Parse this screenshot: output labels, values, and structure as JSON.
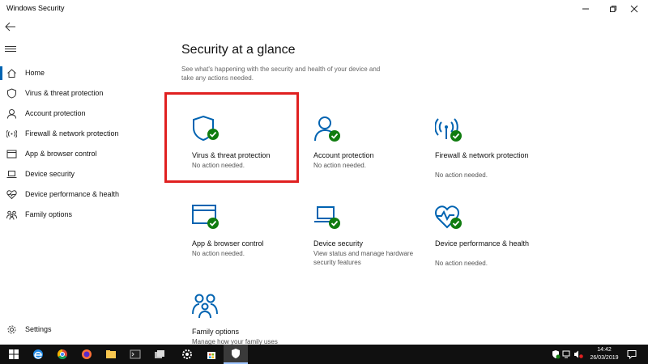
{
  "window": {
    "title": "Windows Security"
  },
  "sidebar": {
    "items": [
      {
        "label": "Home"
      },
      {
        "label": "Virus & threat protection"
      },
      {
        "label": "Account protection"
      },
      {
        "label": "Firewall & network protection"
      },
      {
        "label": "App & browser control"
      },
      {
        "label": "Device security"
      },
      {
        "label": "Device performance & health"
      },
      {
        "label": "Family options"
      }
    ],
    "settings_label": "Settings"
  },
  "main": {
    "title": "Security at a glance",
    "subtitle": "See what's happening with the security and health of your device and take any actions needed.",
    "tiles": [
      {
        "name": "Virus & threat protection",
        "status": "No action needed."
      },
      {
        "name": "Account protection",
        "status": "No action needed."
      },
      {
        "name": "Firewall & network protection",
        "status": "No action needed."
      },
      {
        "name": "App & browser control",
        "status": "No action needed."
      },
      {
        "name": "Device security",
        "status": "View status and manage hardware security features"
      },
      {
        "name": "Device performance & health",
        "status": "No action needed."
      },
      {
        "name": "Family options",
        "status": "Manage how your family uses"
      }
    ]
  },
  "taskbar": {
    "time": "14:42",
    "date": "26/03/2019"
  },
  "colors": {
    "accent": "#0063b1",
    "ok": "#107c10",
    "highlight": "#e02020"
  }
}
